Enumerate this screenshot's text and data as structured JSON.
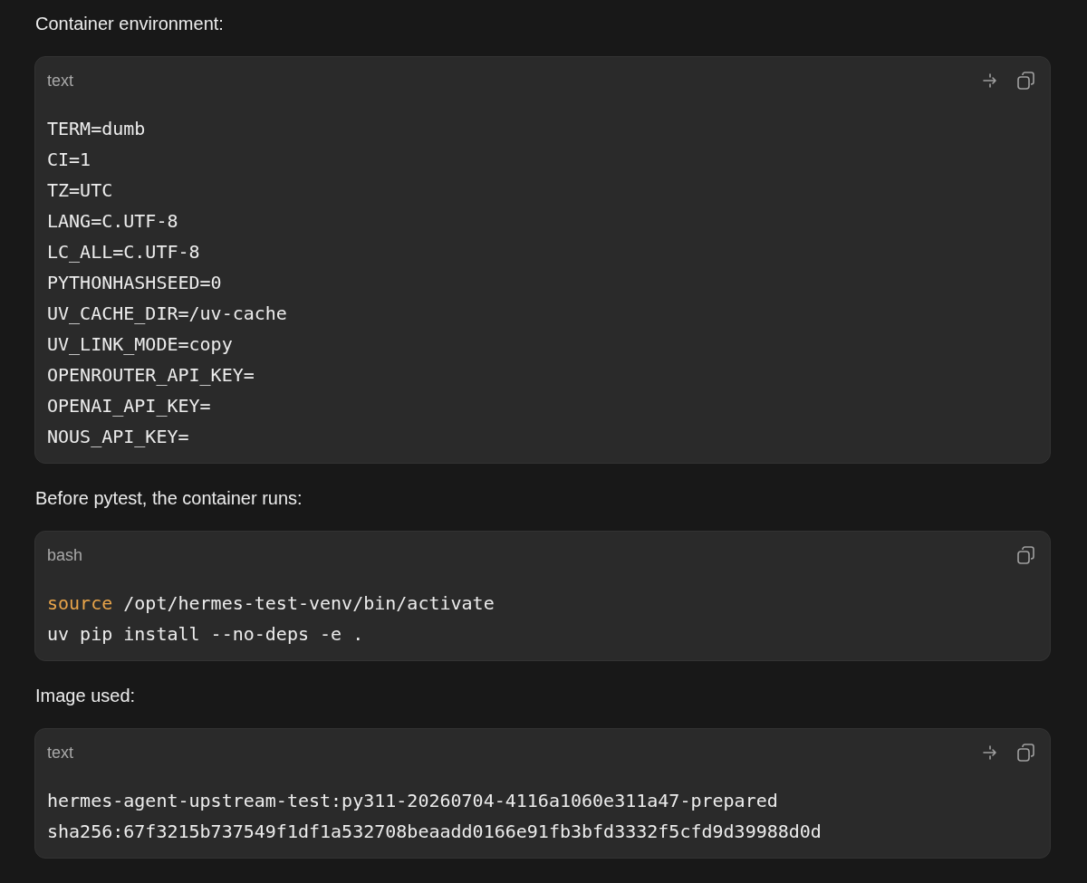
{
  "sections": [
    {
      "heading": "Container environment:",
      "block": {
        "language": "text",
        "buttons": [
          {
            "kind": "wrap"
          },
          {
            "kind": "copy"
          }
        ],
        "lines": [
          [
            {
              "kind": "plain",
              "text": "TERM=dumb"
            }
          ],
          [
            {
              "kind": "plain",
              "text": "CI=1"
            }
          ],
          [
            {
              "kind": "plain",
              "text": "TZ=UTC"
            }
          ],
          [
            {
              "kind": "plain",
              "text": "LANG=C.UTF-8"
            }
          ],
          [
            {
              "kind": "plain",
              "text": "LC_ALL=C.UTF-8"
            }
          ],
          [
            {
              "kind": "plain",
              "text": "PYTHONHASHSEED=0"
            }
          ],
          [
            {
              "kind": "plain",
              "text": "UV_CACHE_DIR=/uv-cache"
            }
          ],
          [
            {
              "kind": "plain",
              "text": "UV_LINK_MODE=copy"
            }
          ],
          [
            {
              "kind": "plain",
              "text": "OPENROUTER_API_KEY="
            }
          ],
          [
            {
              "kind": "plain",
              "text": "OPENAI_API_KEY="
            }
          ],
          [
            {
              "kind": "plain",
              "text": "NOUS_API_KEY="
            }
          ]
        ]
      }
    },
    {
      "heading": "Before pytest, the container runs:",
      "block": {
        "language": "bash",
        "buttons": [
          {
            "kind": "copy"
          }
        ],
        "lines": [
          [
            {
              "kind": "keyword",
              "text": "source"
            },
            {
              "kind": "plain",
              "text": " /opt/hermes-test-venv/bin/activate"
            }
          ],
          [
            {
              "kind": "plain",
              "text": "uv pip install --no-deps -e ."
            }
          ]
        ]
      }
    },
    {
      "heading": "Image used:",
      "block": {
        "language": "text",
        "buttons": [
          {
            "kind": "wrap"
          },
          {
            "kind": "copy"
          }
        ],
        "lines": [
          [
            {
              "kind": "plain",
              "text": "hermes-agent-upstream-test:py311-20260704-4116a1060e311a47-prepared"
            }
          ],
          [
            {
              "kind": "plain",
              "text": "sha256:67f3215b737549f1df1a532708beaadd0166e91fb3bfd3332f5cfd9d39988d0d"
            }
          ]
        ]
      }
    }
  ]
}
